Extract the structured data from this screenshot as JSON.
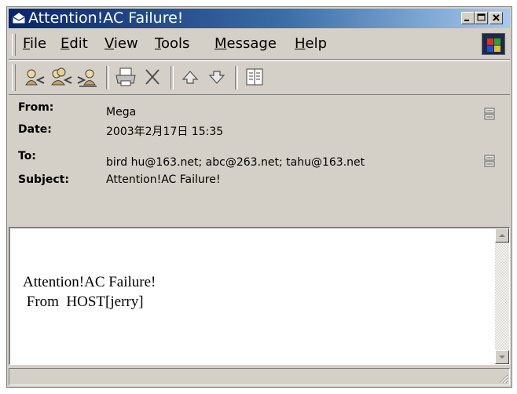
{
  "window": {
    "title": "Attention!AC Failure!"
  },
  "menu": {
    "items": [
      "File",
      "Edit",
      "View",
      "Tools",
      "Message",
      "Help"
    ]
  },
  "toolbar": {
    "buttons": [
      "reply-icon",
      "reply-all-icon",
      "forward-icon",
      "print-icon",
      "delete-icon",
      "previous-icon",
      "next-icon",
      "address-book-icon"
    ]
  },
  "header": {
    "from_label": "From:",
    "from_value": "Mega",
    "date_label": "Date:",
    "date_value": "2003年2月17日 15:35",
    "to_label": "To:",
    "to_value": "bird hu@163.net; abc@263.net; tahu@163.net",
    "subject_label": "Subject:",
    "subject_value": "Attention!AC Failure!"
  },
  "body": {
    "line1": "Attention!AC Failure!",
    "line2": " From  HOST[jerry]"
  },
  "status": {
    "text": ""
  }
}
